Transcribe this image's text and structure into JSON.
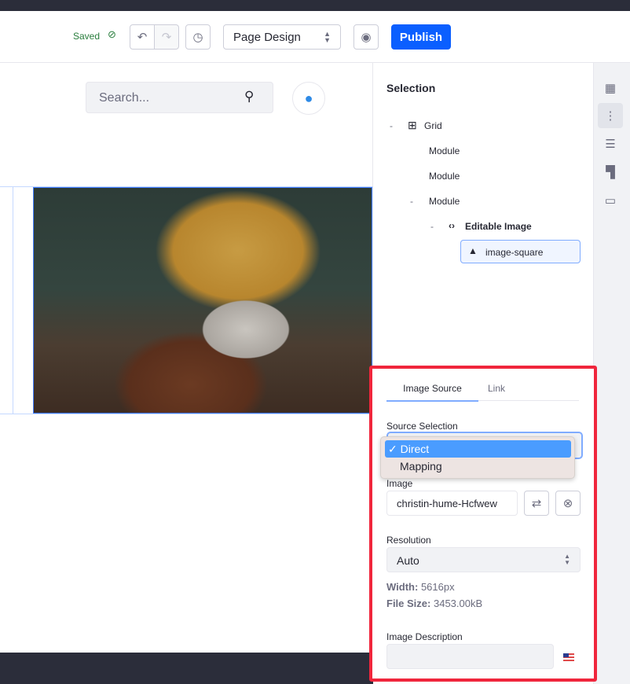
{
  "toolbar": {
    "saved_label": "Saved",
    "mode_select": "Page Design",
    "publish_label": "Publish"
  },
  "canvas": {
    "search_placeholder": "Search..."
  },
  "selection": {
    "title": "Selection",
    "tree": [
      {
        "label": "Grid",
        "toggle": "-"
      },
      {
        "label": "Module"
      },
      {
        "label": "Module"
      },
      {
        "label": "Module",
        "toggle": "-"
      },
      {
        "label": "Editable Image",
        "toggle": "-"
      },
      {
        "label": "image-square"
      }
    ]
  },
  "config": {
    "tabs": [
      "Image Source",
      "Link"
    ],
    "source_selection_label": "Source Selection",
    "source_options": [
      {
        "label": "Direct",
        "selected": true
      },
      {
        "label": "Mapping"
      }
    ],
    "check_mark": "✓",
    "image_label": "Image",
    "image_value": "christin-hume-Hcfwew",
    "resolution_label": "Resolution",
    "resolution_value": "Auto",
    "width_label": "Width:",
    "width_value": "5616px",
    "file_size_label": "File Size:",
    "file_size_value": "3453.00kB",
    "description_label": "Image Description",
    "description_value": ""
  },
  "colors": {
    "accent": "#0b5fff",
    "highlight": "#f0263c",
    "saved": "#287d3c"
  }
}
